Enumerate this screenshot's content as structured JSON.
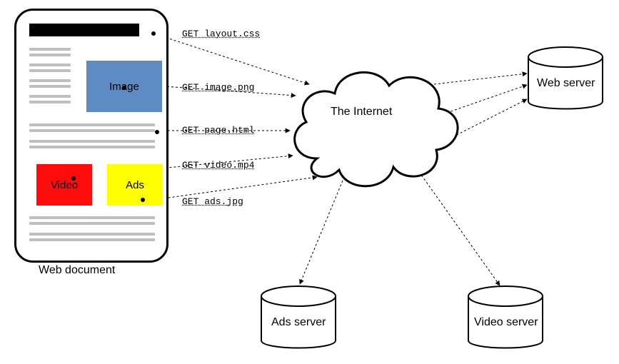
{
  "document": {
    "caption": "Web document",
    "image_label": "Image",
    "video_label": "Video",
    "ads_label": "Ads"
  },
  "requests": {
    "layout": "GET layout.css",
    "image": "GET image.png",
    "page": "GET page.html",
    "video": "GET video.mp4",
    "ads": "GET ads.jpg"
  },
  "cloud": {
    "label": "The Internet"
  },
  "servers": {
    "web": "Web server",
    "ads": "Ads server",
    "video": "Video server"
  }
}
